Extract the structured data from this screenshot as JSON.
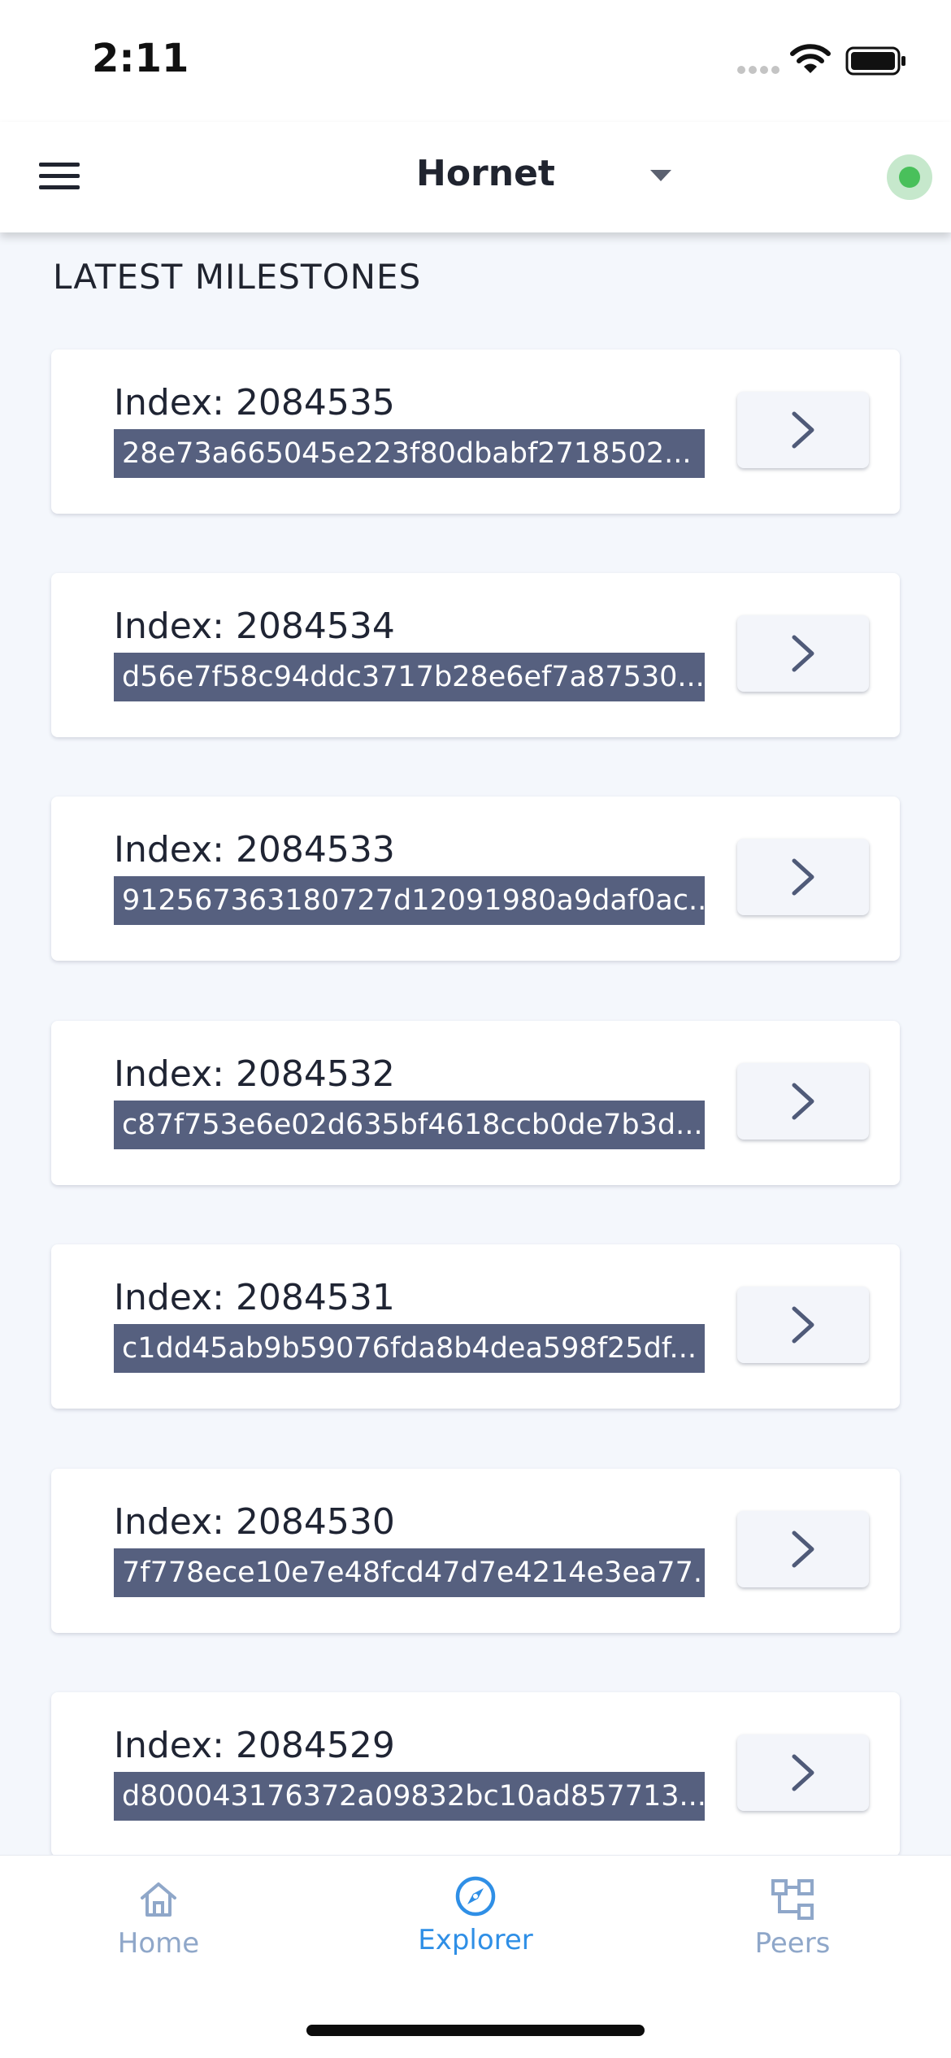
{
  "status_bar": {
    "time": "2:11"
  },
  "header": {
    "title": "Hornet",
    "connection_status": "online"
  },
  "section": {
    "title": "LATEST MILESTONES"
  },
  "milestones": [
    {
      "index_label": "Index: 2084535",
      "hash": "28e73a665045e223f80dbabf2718502..."
    },
    {
      "index_label": "Index: 2084534",
      "hash": "d56e7f58c94ddc3717b28e6ef7a87530..."
    },
    {
      "index_label": "Index: 2084533",
      "hash": "912567363180727d12091980a9daf0ac..."
    },
    {
      "index_label": "Index: 2084532",
      "hash": "c87f753e6e02d635bf4618ccb0de7b3d..."
    },
    {
      "index_label": "Index: 2084531",
      "hash": "c1dd45ab9b59076fda8b4dea598f25df..."
    },
    {
      "index_label": "Index: 2084530",
      "hash": "7f778ece10e7e48fcd47d7e4214e3ea77..."
    },
    {
      "index_label": "Index: 2084529",
      "hash": "d800043176372a09832bc10ad857713..."
    }
  ],
  "nav": {
    "home": "Home",
    "explorer": "Explorer",
    "peers": "Peers",
    "active": "explorer"
  },
  "colors": {
    "accent": "#2f8fe6",
    "inactive": "#8fa7c9",
    "hash_bg": "#56607f",
    "status_green": "#49c05b"
  }
}
